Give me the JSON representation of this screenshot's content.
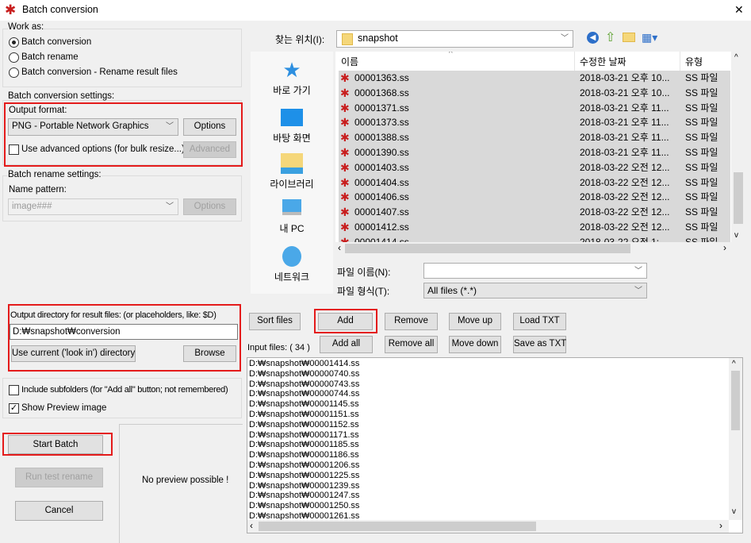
{
  "window": {
    "title": "Batch conversion",
    "close_label": "✕"
  },
  "work_as": {
    "label": "Work as:",
    "options": [
      {
        "label": "Batch conversion",
        "selected": true
      },
      {
        "label": "Batch rename",
        "selected": false
      },
      {
        "label": "Batch conversion - Rename result files",
        "selected": false
      }
    ]
  },
  "conversion": {
    "label": "Batch conversion settings:",
    "output_format_label": "Output format:",
    "output_format_value": "PNG - Portable Network Graphics",
    "options_label": "Options",
    "advanced_checkbox_label": "Use advanced options (for bulk resize...)",
    "advanced_checked": false,
    "advanced_label": "Advanced"
  },
  "rename": {
    "label": "Batch rename settings:",
    "name_pattern_label": "Name pattern:",
    "name_pattern_value": "image###",
    "options_label": "Options"
  },
  "output": {
    "label": "Output directory for result files: (or placeholders, like: $D)",
    "value": "D:₩snapshot₩conversion",
    "use_current_label": "Use current ('look in') directory",
    "browse_label": "Browse"
  },
  "flags": {
    "include_subfolders_label": "Include subfolders (for \"Add all\" button; not remembered)",
    "include_subfolders": false,
    "show_preview_label": "Show Preview image",
    "show_preview": true
  },
  "actions": {
    "start_label": "Start Batch",
    "test_rename_label": "Run test rename",
    "cancel_label": "Cancel"
  },
  "preview": {
    "text": "No preview possible !"
  },
  "browser": {
    "look_in_label": "찾는 위치(I):",
    "look_in_value": "snapshot",
    "places": [
      {
        "label": "바로 가기",
        "icon": "quick-access-star-icon"
      },
      {
        "label": "바탕 화면",
        "icon": "desktop-icon"
      },
      {
        "label": "라이브러리",
        "icon": "libraries-icon"
      },
      {
        "label": "내 PC",
        "icon": "this-pc-icon"
      },
      {
        "label": "네트워크",
        "icon": "network-icon"
      }
    ],
    "columns": [
      "이름",
      "수정한 날짜",
      "유형"
    ],
    "files": [
      {
        "name": "00001363.ss",
        "date": "2018-03-21 오후 10...",
        "type": "SS 파일"
      },
      {
        "name": "00001368.ss",
        "date": "2018-03-21 오후 10...",
        "type": "SS 파일"
      },
      {
        "name": "00001371.ss",
        "date": "2018-03-21 오후 11...",
        "type": "SS 파일"
      },
      {
        "name": "00001373.ss",
        "date": "2018-03-21 오후 11...",
        "type": "SS 파일"
      },
      {
        "name": "00001388.ss",
        "date": "2018-03-21 오후 11...",
        "type": "SS 파일"
      },
      {
        "name": "00001390.ss",
        "date": "2018-03-21 오후 11...",
        "type": "SS 파일"
      },
      {
        "name": "00001403.ss",
        "date": "2018-03-22 오전 12...",
        "type": "SS 파일"
      },
      {
        "name": "00001404.ss",
        "date": "2018-03-22 오전 12...",
        "type": "SS 파일"
      },
      {
        "name": "00001406.ss",
        "date": "2018-03-22 오전 12...",
        "type": "SS 파일"
      },
      {
        "name": "00001407.ss",
        "date": "2018-03-22 오전 12...",
        "type": "SS 파일"
      },
      {
        "name": "00001412.ss",
        "date": "2018-03-22 오전 12...",
        "type": "SS 파일"
      },
      {
        "name": "00001414.ss",
        "date": "2018-03-22 오전 1:",
        "type": "SS 파일"
      }
    ],
    "file_name_label": "파일 이름(N):",
    "file_name_value": "",
    "file_type_label": "파일 형식(T):",
    "file_type_value": "All files (*.*)"
  },
  "list_buttons": {
    "sort": "Sort files",
    "add": "Add",
    "remove": "Remove",
    "move_up": "Move up",
    "load_txt": "Load TXT",
    "add_all": "Add all",
    "remove_all": "Remove all",
    "move_down": "Move down",
    "save_txt": "Save as TXT"
  },
  "input_files": {
    "label": "Input files: ( 34 )",
    "items": [
      "D:₩snapshot₩00001414.ss",
      "D:₩snapshot₩00000740.ss",
      "D:₩snapshot₩00000743.ss",
      "D:₩snapshot₩00000744.ss",
      "D:₩snapshot₩00001145.ss",
      "D:₩snapshot₩00001151.ss",
      "D:₩snapshot₩00001152.ss",
      "D:₩snapshot₩00001171.ss",
      "D:₩snapshot₩00001185.ss",
      "D:₩snapshot₩00001186.ss",
      "D:₩snapshot₩00001206.ss",
      "D:₩snapshot₩00001225.ss",
      "D:₩snapshot₩00001239.ss",
      "D:₩snapshot₩00001247.ss",
      "D:₩snapshot₩00001250.ss",
      "D:₩snapshot₩00001261.ss"
    ]
  },
  "colors": {
    "highlight_box": "#e41b1b",
    "selection": "#d9d9d9"
  }
}
